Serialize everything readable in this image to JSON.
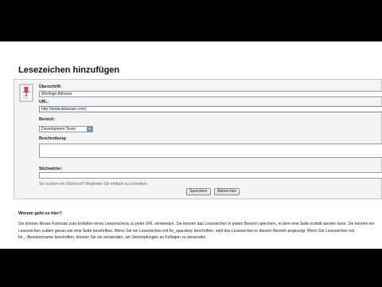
{
  "page": {
    "title": "Lesezeichen hinzufügen"
  },
  "form": {
    "title_label": "Überschrift:",
    "title_value": "Wichtige Adresse",
    "url_label": "URL:",
    "url_value": "http://www.atlassian.com/",
    "area_label": "Bereich:",
    "area_value": "Development Team",
    "description_label": "Beschreibung:",
    "description_value": "",
    "keywords_label": "Stichwörter:",
    "keywords_value": "",
    "hint": "Sie suchen ein Stichwort? Beginnen Sie einfach zu schreiben.",
    "save_label": "Speichern",
    "cancel_label": "Abbrechen",
    "icon": "bookmark-pushpin-icon"
  },
  "help": {
    "title": "Worum geht es hier?",
    "paragraph": "Sie können dieses Formular zum Erstellen eines Lesezeichens zu jeder URL verwenden. Sie können das Lesezeichen in jedem Bereich speichern, in dem eine Seite erstellt werden kann. Sie können ein Lesezeichen zudem genau wie eine Seite beschriften. Wenn Sie ein Lesezeichen mit for_spacekey beschriften, wird das Lesezeichen in diesem Bereich angezeigt. Wenn Sie Lesezeichen mit for_~Benutzername beschriften, können Sie sie verwenden, um Verknüpfungen an Kollegen zu versenden."
  },
  "colors": {
    "accent": "#6f8fd0",
    "background": "#ffffff",
    "letterbox": "#000000"
  }
}
